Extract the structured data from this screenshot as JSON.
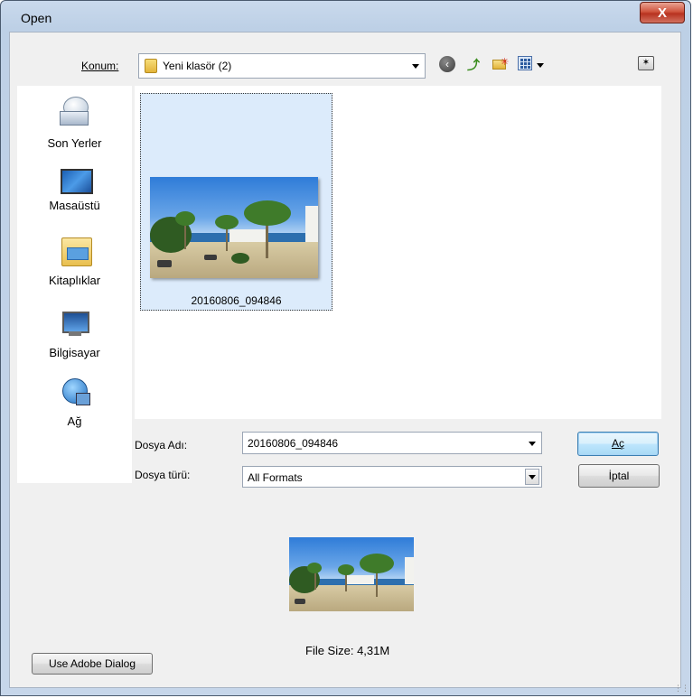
{
  "window": {
    "title": "Open",
    "close_glyph": "X"
  },
  "location": {
    "label": "Konum:",
    "folder": "Yeni klasör (2)",
    "folder_icon": "folder-icon"
  },
  "toolbar": {
    "back_icon": "back-arrow-icon",
    "up_icon": "up-folder-icon",
    "new_folder_icon": "new-folder-icon",
    "view_icon": "view-menu-icon",
    "desktop_icon": "desktop-icon"
  },
  "places": [
    {
      "label": "Son Yerler",
      "icon": "recent-places-icon"
    },
    {
      "label": "Masaüstü",
      "icon": "desktop-icon"
    },
    {
      "label": "Kitaplıklar",
      "icon": "libraries-icon"
    },
    {
      "label": "Bilgisayar",
      "icon": "computer-icon"
    },
    {
      "label": "Ağ",
      "icon": "network-icon"
    }
  ],
  "files": [
    {
      "name": "20160806_094846",
      "selected": true
    }
  ],
  "file_name": {
    "label": "Dosya Adı:",
    "value": "20160806_094846"
  },
  "file_type": {
    "label": "Dosya türü:",
    "value": "All Formats"
  },
  "buttons": {
    "open": "Aç",
    "cancel": "İptal",
    "adobe": "Use Adobe Dialog"
  },
  "preview": {
    "file_size": "File Size: 4,31M"
  },
  "colors": {
    "selection": "#dcebfb",
    "title_bar": "#c9d9ec",
    "close_button": "#c8432e"
  }
}
